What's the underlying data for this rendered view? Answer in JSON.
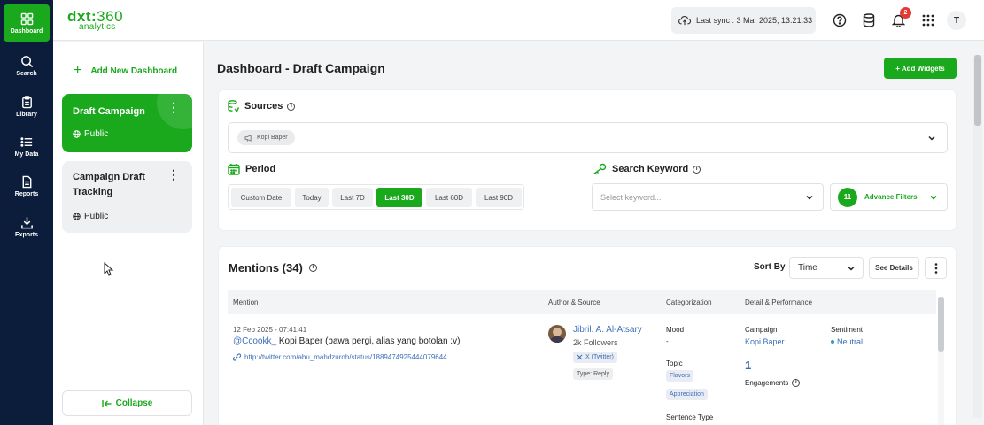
{
  "rail": [
    {
      "label": "Dashboard",
      "icon": "grid-icon",
      "active": true
    },
    {
      "label": "Search",
      "icon": "search-icon"
    },
    {
      "label": "Library",
      "icon": "clipboard-icon"
    },
    {
      "label": "My Data",
      "icon": "list-icon"
    },
    {
      "label": "Reports",
      "icon": "document-icon"
    },
    {
      "label": "Exports",
      "icon": "download-icon"
    }
  ],
  "topbar": {
    "logo_main": "dxt",
    "logo_num": "360",
    "logo_sub": "analytics",
    "sync_text": "Last sync : 3 Mar 2025, 13:21:33",
    "notif_count": "2",
    "avatar_initial": "T"
  },
  "dashboards": {
    "add_label": "Add New Dashboard",
    "items": [
      {
        "title": "Draft Campaign",
        "visibility": "Public",
        "active": true
      },
      {
        "title": "Campaign Draft Tracking",
        "visibility": "Public",
        "active": false
      }
    ],
    "collapse_label": "Collapse"
  },
  "main": {
    "title": "Dashboard - Draft Campaign",
    "add_widgets_label": "+ Add Widgets",
    "sources_label": "Sources",
    "source_chip": "Kopi Baper",
    "period_label": "Period",
    "period_options": [
      "Custom Date",
      "Today",
      "Last 7D",
      "Last 30D",
      "Last 60D",
      "Last 90D"
    ],
    "period_selected": "Last 30D",
    "keyword_label": "Search Keyword",
    "keyword_placeholder": "Select keyword...",
    "advance_count": "11",
    "advance_label": "Advance Filters"
  },
  "mentions": {
    "title": "Mentions (34)",
    "sort_label": "Sort By",
    "sort_value": "Time",
    "see_details": "See Details",
    "columns": [
      "Mention",
      "Author & Source",
      "Categorization",
      "Detail & Performance"
    ],
    "rows": [
      {
        "timestamp": "12 Feb 2025 - 07:41:41",
        "handle": "@Ccookk_",
        "text": "Kopi Baper (bawa pergi, alias yang botolan :v)",
        "url": "http://twitter.com/abu_mahdzuroh/status/1889474925444079644",
        "author": "Jibril. A. Al-Atsary",
        "followers": "2k Followers",
        "platform": "X (Twitter)",
        "type": "Type: Reply",
        "mood_label": "Mood",
        "mood_value": "-",
        "topic_label": "Topic",
        "topics": [
          "Flavors",
          "Appreciation"
        ],
        "sentence_label": "Sentence Type",
        "campaign_label": "Campaign",
        "campaign_value": "Kopi Baper",
        "engagements_value": "1",
        "engagements_label": "Engagements",
        "sentiment_label": "Sentiment",
        "sentiment_value": "Neutral"
      }
    ]
  },
  "colors": {
    "brand_green": "#1aa81d",
    "rail_navy": "#0b1d3a",
    "link_blue": "#3d6fb8",
    "badge_red": "#e53935"
  }
}
